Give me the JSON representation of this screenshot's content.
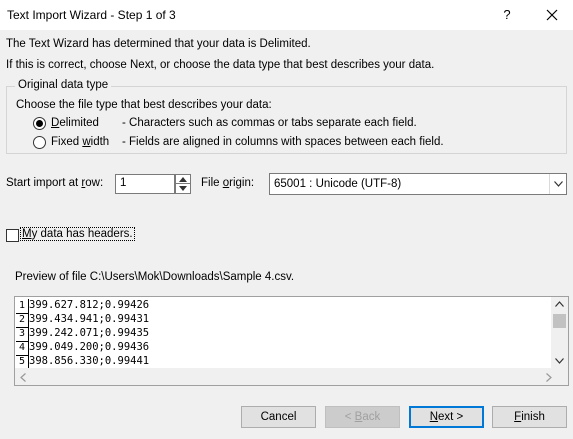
{
  "window": {
    "title": "Text Import Wizard - Step 1 of 3",
    "help_label": "?"
  },
  "intro": {
    "line1": "The Text Wizard has determined that your data is Delimited.",
    "line2": "If this is correct, choose Next, or choose the data type that best describes your data."
  },
  "data_type": {
    "legend": "Original data type",
    "prompt": "Choose the file type that best describes your data:",
    "options": [
      {
        "key": "D",
        "rest": "elimited",
        "description": "- Characters such as commas or tabs separate each field.",
        "selected": true
      },
      {
        "pre": "Fixed ",
        "key": "w",
        "rest": "idth",
        "description": "- Fields are aligned in columns with spaces between each field.",
        "selected": false
      }
    ]
  },
  "start_row": {
    "label_pre": "Start import at ",
    "label_key": "r",
    "label_post": "ow:",
    "value": "1"
  },
  "file_origin": {
    "label_pre": "File ",
    "label_key": "o",
    "label_post": "rigin:",
    "value": "65001 : Unicode (UTF-8)"
  },
  "headers_checkbox": {
    "label_key": "M",
    "label_rest": "y data has headers.",
    "checked": false
  },
  "preview": {
    "label": "Preview of file C:\\Users\\Mok\\Downloads\\Sample 4.csv.",
    "lines": [
      {
        "num": "1",
        "text": "399.627.812;0.99426"
      },
      {
        "num": "2",
        "text": "399.434.941;0.99431"
      },
      {
        "num": "3",
        "text": "399.242.071;0.99435"
      },
      {
        "num": "4",
        "text": "399.049.200;0.99436"
      },
      {
        "num": "5",
        "text": "398.856.330;0.99441"
      }
    ]
  },
  "buttons": {
    "cancel": "Cancel",
    "back_pre": "< ",
    "back_key": "B",
    "back_rest": "ack",
    "next_key": "N",
    "next_rest": "ext >",
    "finish_key": "F",
    "finish_rest": "inish"
  }
}
